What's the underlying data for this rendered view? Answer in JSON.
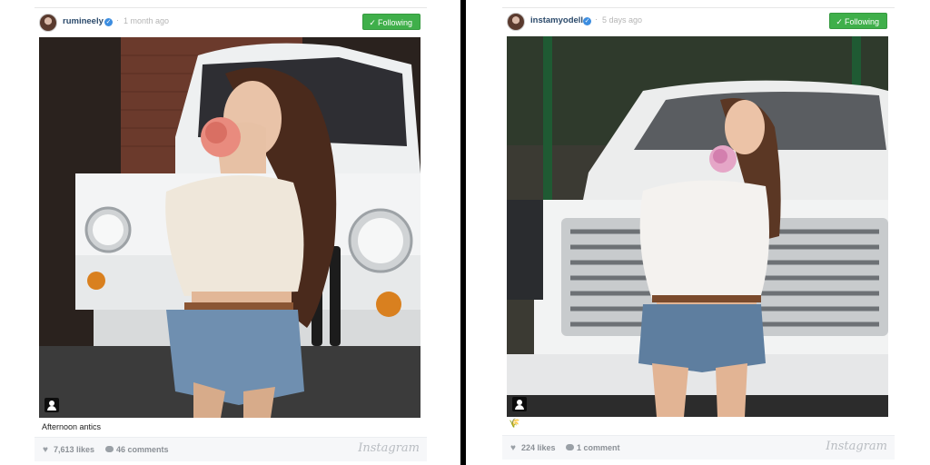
{
  "posts": [
    {
      "username": "rumineely",
      "verified_icon": "verified-badge-icon",
      "separator": "·",
      "time": "1 month ago",
      "follow_label": "Following",
      "caption": "Afternoon antics",
      "likes": "7,613 likes",
      "comments": "46 comments",
      "brand": "Instagram"
    },
    {
      "username": "instamyodell",
      "verified_icon": "verified-badge-icon",
      "separator": "·",
      "time": "5 days ago",
      "follow_label": "Following",
      "caption_emoji": "🌾",
      "likes": "224 likes",
      "comments": "1 comment",
      "brand": "Instagram"
    }
  ],
  "colors": {
    "follow_green": "#3faf4a",
    "username_blue": "#2b4a6b",
    "verified_blue": "#3c8de0",
    "divider": "#000000"
  }
}
